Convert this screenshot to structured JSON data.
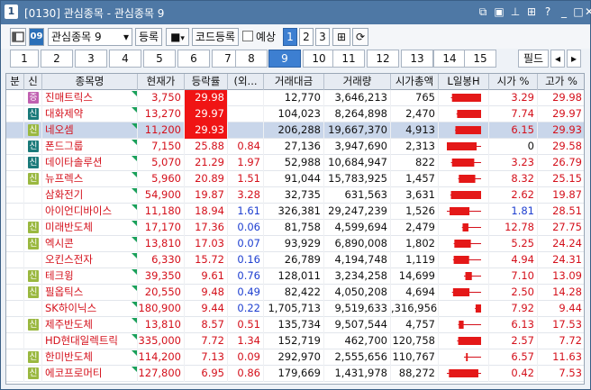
{
  "title": {
    "window_number": "1",
    "text": "[0130] 관심종목 - 관심종목 9"
  },
  "toolbar": {
    "group_select": "관심종목 9",
    "register_button": "등록",
    "code_register_button": "코드등록",
    "forecast_label": "예상",
    "forecast_checked": false,
    "pages": [
      "1",
      "2",
      "3"
    ],
    "selected_page": "1"
  },
  "tabs": {
    "items": [
      "1",
      "2",
      "3",
      "4",
      "5",
      "6",
      "7",
      "8",
      "9",
      "10",
      "11",
      "12",
      "13",
      "14",
      "15"
    ],
    "selected": "9",
    "filter_button": "필드"
  },
  "columns": [
    "분",
    "신",
    "종목명",
    "현재가",
    "등락률",
    "(외...",
    "거래대금",
    "거래량",
    "시가총액",
    "L일봉H",
    "시가 %",
    "고가 %"
  ],
  "rows": [
    {
      "badge": "증",
      "badge_color": "#c060b0",
      "name": "진매트릭스",
      "price": "3,750",
      "rate": "29.98",
      "rate_red": true,
      "fgn": "",
      "fgn_color": "",
      "amount": "12,770",
      "volume": "3,646,213",
      "cap": "765",
      "open_pct": "3.29",
      "high_pct": "29.98",
      "open_color": "red",
      "candle": {
        "o": 0.15,
        "c": 1.0,
        "l": 0.12,
        "h": 1.0,
        "up": true
      }
    },
    {
      "badge": "신",
      "badge_color": "#1a7a7a",
      "name": "대화제약",
      "price": "13,270",
      "rate": "29.97",
      "rate_red": true,
      "fgn": "",
      "fgn_color": "",
      "amount": "104,023",
      "volume": "8,264,898",
      "cap": "2,470",
      "open_pct": "7.74",
      "high_pct": "29.97",
      "open_color": "red",
      "candle": {
        "o": 0.3,
        "c": 1.0,
        "l": 0.28,
        "h": 1.0,
        "up": true
      }
    },
    {
      "badge": "신",
      "badge_color": "#9ab840",
      "name": "네오셈",
      "price": "11,200",
      "rate": "29.93",
      "rate_red": true,
      "fgn": "",
      "fgn_color": "",
      "amount": "206,288",
      "volume": "19,667,370",
      "cap": "4,913",
      "open_pct": "6.15",
      "high_pct": "29.93",
      "open_color": "red",
      "candle": {
        "o": 0.25,
        "c": 1.0,
        "l": 0.24,
        "h": 1.0,
        "up": true
      }
    },
    {
      "badge": "신",
      "badge_color": "#1a7a7a",
      "name": "폰드그룹",
      "price": "7,150",
      "rate": "25.88",
      "rate_red": false,
      "fgn": "0.84",
      "fgn_color": "red",
      "amount": "27,136",
      "volume": "3,947,690",
      "cap": "2,313",
      "open_pct": "0",
      "high_pct": "29.58",
      "open_color": "blk",
      "candle": {
        "o": 0.0,
        "c": 0.87,
        "l": 0.0,
        "h": 1.0,
        "up": true
      }
    },
    {
      "badge": "신",
      "badge_color": "#1a7a7a",
      "name": "데이타솔루션",
      "price": "5,070",
      "rate": "21.29",
      "rate_red": false,
      "fgn": "1.97",
      "fgn_color": "red",
      "amount": "52,988",
      "volume": "10,684,947",
      "cap": "822",
      "open_pct": "3.23",
      "high_pct": "26.79",
      "open_color": "red",
      "candle": {
        "o": 0.15,
        "c": 0.8,
        "l": 0.12,
        "h": 1.0,
        "up": true
      }
    },
    {
      "badge": "신",
      "badge_color": "#9ab840",
      "name": "뉴프렉스",
      "price": "5,960",
      "rate": "20.89",
      "rate_red": false,
      "fgn": "1.51",
      "fgn_color": "red",
      "amount": "91,044",
      "volume": "15,783,925",
      "cap": "1,457",
      "open_pct": "8.32",
      "high_pct": "25.15",
      "open_color": "red",
      "candle": {
        "o": 0.35,
        "c": 0.83,
        "l": 0.33,
        "h": 1.0,
        "up": true
      }
    },
    {
      "badge": "",
      "badge_color": "",
      "name": "삼화전기",
      "price": "54,900",
      "rate": "19.87",
      "rate_red": false,
      "fgn": "3.28",
      "fgn_color": "red",
      "amount": "32,735",
      "volume": "631,563",
      "cap": "3,631",
      "open_pct": "2.62",
      "high_pct": "19.87",
      "open_color": "red",
      "candle": {
        "o": 0.12,
        "c": 1.0,
        "l": 0.1,
        "h": 1.0,
        "up": true
      }
    },
    {
      "badge": "",
      "badge_color": "",
      "name": "아이언디바이스",
      "price": "11,180",
      "rate": "18.94",
      "rate_red": false,
      "fgn": "1.61",
      "fgn_color": "blue",
      "amount": "326,381",
      "volume": "29,247,239",
      "cap": "1,526",
      "open_pct": "1.81",
      "high_pct": "28.51",
      "open_color": "blue",
      "candle": {
        "o": 0.08,
        "c": 0.66,
        "l": 0.0,
        "h": 1.0,
        "up": true
      }
    },
    {
      "badge": "신",
      "badge_color": "#9ab840",
      "name": "미래반도체",
      "price": "17,170",
      "rate": "17.36",
      "rate_red": false,
      "fgn": "0.06",
      "fgn_color": "blue",
      "amount": "81,758",
      "volume": "4,599,694",
      "cap": "2,479",
      "open_pct": "12.78",
      "high_pct": "27.75",
      "open_color": "red",
      "candle": {
        "o": 0.46,
        "c": 0.63,
        "l": 0.44,
        "h": 1.0,
        "up": true
      }
    },
    {
      "badge": "신",
      "badge_color": "#9ab840",
      "name": "엑시콘",
      "price": "13,810",
      "rate": "17.03",
      "rate_red": false,
      "fgn": "0.07",
      "fgn_color": "blue",
      "amount": "93,929",
      "volume": "6,890,008",
      "cap": "1,802",
      "open_pct": "5.25",
      "high_pct": "24.24",
      "open_color": "red",
      "candle": {
        "o": 0.22,
        "c": 0.7,
        "l": 0.2,
        "h": 1.0,
        "up": true
      }
    },
    {
      "badge": "",
      "badge_color": "",
      "name": "오킨스전자",
      "price": "6,330",
      "rate": "15.72",
      "rate_red": false,
      "fgn": "0.16",
      "fgn_color": "blue",
      "amount": "26,789",
      "volume": "4,194,748",
      "cap": "1,119",
      "open_pct": "4.94",
      "high_pct": "24.31",
      "open_color": "red",
      "candle": {
        "o": 0.2,
        "c": 0.65,
        "l": 0.18,
        "h": 1.0,
        "up": true
      }
    },
    {
      "badge": "신",
      "badge_color": "#9ab840",
      "name": "테크윙",
      "price": "39,350",
      "rate": "9.61",
      "rate_red": false,
      "fgn": "0.76",
      "fgn_color": "blue",
      "amount": "128,011",
      "volume": "3,234,258",
      "cap": "14,699",
      "open_pct": "7.10",
      "high_pct": "13.09",
      "open_color": "red",
      "candle": {
        "o": 0.54,
        "c": 0.73,
        "l": 0.5,
        "h": 1.0,
        "up": true
      }
    },
    {
      "badge": "신",
      "badge_color": "#9ab840",
      "name": "필옵틱스",
      "price": "20,550",
      "rate": "9.48",
      "rate_red": false,
      "fgn": "0.49",
      "fgn_color": "blue",
      "amount": "82,422",
      "volume": "4,050,208",
      "cap": "4,694",
      "open_pct": "2.50",
      "high_pct": "14.28",
      "open_color": "red",
      "candle": {
        "o": 0.18,
        "c": 0.66,
        "l": 0.15,
        "h": 1.0,
        "up": true
      }
    },
    {
      "badge": "",
      "badge_color": "",
      "name": "SK하이닉스",
      "price": "180,900",
      "rate": "9.44",
      "rate_red": false,
      "fgn": "0.22",
      "fgn_color": "blue",
      "amount": "1,705,713",
      "volume": "9,519,633",
      "cap": ",316,956",
      "open_pct": "7.92",
      "high_pct": "9.44",
      "open_color": "red",
      "candle": {
        "o": 0.84,
        "c": 1.0,
        "l": 0.82,
        "h": 1.0,
        "up": true
      }
    },
    {
      "badge": "신",
      "badge_color": "#9ab840",
      "name": "제주반도체",
      "price": "13,810",
      "rate": "8.57",
      "rate_red": false,
      "fgn": "0.51",
      "fgn_color": "red",
      "amount": "135,734",
      "volume": "9,507,544",
      "cap": "4,757",
      "open_pct": "6.13",
      "high_pct": "17.53",
      "open_color": "red",
      "candle": {
        "o": 0.35,
        "c": 0.49,
        "l": 0.33,
        "h": 1.0,
        "up": true
      }
    },
    {
      "badge": "",
      "badge_color": "",
      "name": "HD현대일렉트릭",
      "price": "335,000",
      "rate": "7.72",
      "rate_red": false,
      "fgn": "1.34",
      "fgn_color": "red",
      "amount": "152,719",
      "volume": "462,700",
      "cap": "120,758",
      "open_pct": "2.57",
      "high_pct": "7.72",
      "open_color": "red",
      "candle": {
        "o": 0.33,
        "c": 1.0,
        "l": 0.3,
        "h": 1.0,
        "up": true
      }
    },
    {
      "badge": "신",
      "badge_color": "#9ab840",
      "name": "한미반도체",
      "price": "114,200",
      "rate": "7.13",
      "rate_red": false,
      "fgn": "0.09",
      "fgn_color": "red",
      "amount": "292,970",
      "volume": "2,555,656",
      "cap": "110,767",
      "open_pct": "6.57",
      "high_pct": "11.63",
      "open_color": "red",
      "candle": {
        "o": 0.56,
        "c": 0.61,
        "l": 0.5,
        "h": 1.0,
        "up": true
      }
    },
    {
      "badge": "신",
      "badge_color": "#9ab840",
      "name": "에코프로머티",
      "price": "127,800",
      "rate": "6.95",
      "rate_red": false,
      "fgn": "0.86",
      "fgn_color": "red",
      "amount": "179,669",
      "volume": "1,431,978",
      "cap": "88,272",
      "open_pct": "0.42",
      "high_pct": "7.53",
      "open_color": "red",
      "candle": {
        "o": 0.06,
        "c": 0.92,
        "l": 0.0,
        "h": 1.0,
        "up": true
      }
    }
  ],
  "colors": {
    "titlebar": "#4e78a5",
    "accent": "#3d7fd1",
    "up_red": "#d4101b",
    "down_blue": "#1e3fd0",
    "limit_up_bg": "#f01414",
    "highlight_row": "#c9d6ea"
  }
}
